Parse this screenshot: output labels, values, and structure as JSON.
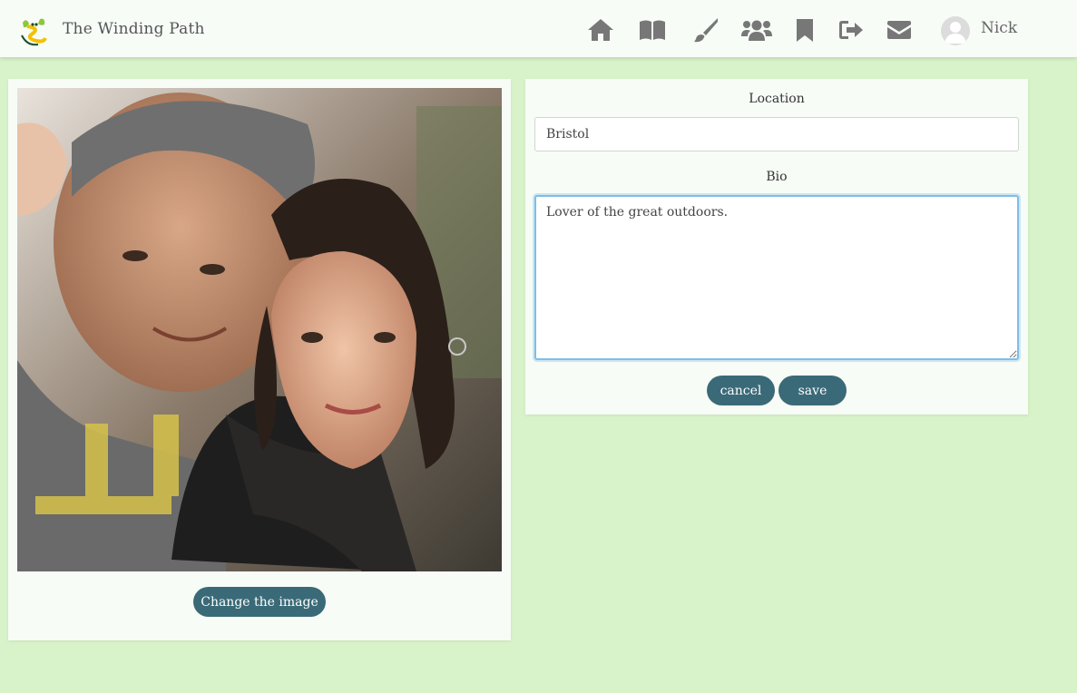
{
  "header": {
    "brand_title": "The Winding Path",
    "user_name": "Nick",
    "nav_icons": [
      "home-icon",
      "book-icon",
      "brush-icon",
      "users-icon",
      "bookmark-icon",
      "sign-out-icon",
      "envelope-icon"
    ]
  },
  "image_panel": {
    "change_image_label": "Change the image"
  },
  "profile_form": {
    "location_label": "Location",
    "location_value": "Bristol",
    "bio_label": "Bio",
    "bio_value": "Lover of the great outdoors. ",
    "cancel_label": "cancel",
    "save_label": "save"
  },
  "colors": {
    "page_background": "#d8f3c9",
    "card_background": "#f7fcf7",
    "button": "#3a6a78",
    "focus_ring": "#7fbde8",
    "nav_icon": "#777777"
  }
}
